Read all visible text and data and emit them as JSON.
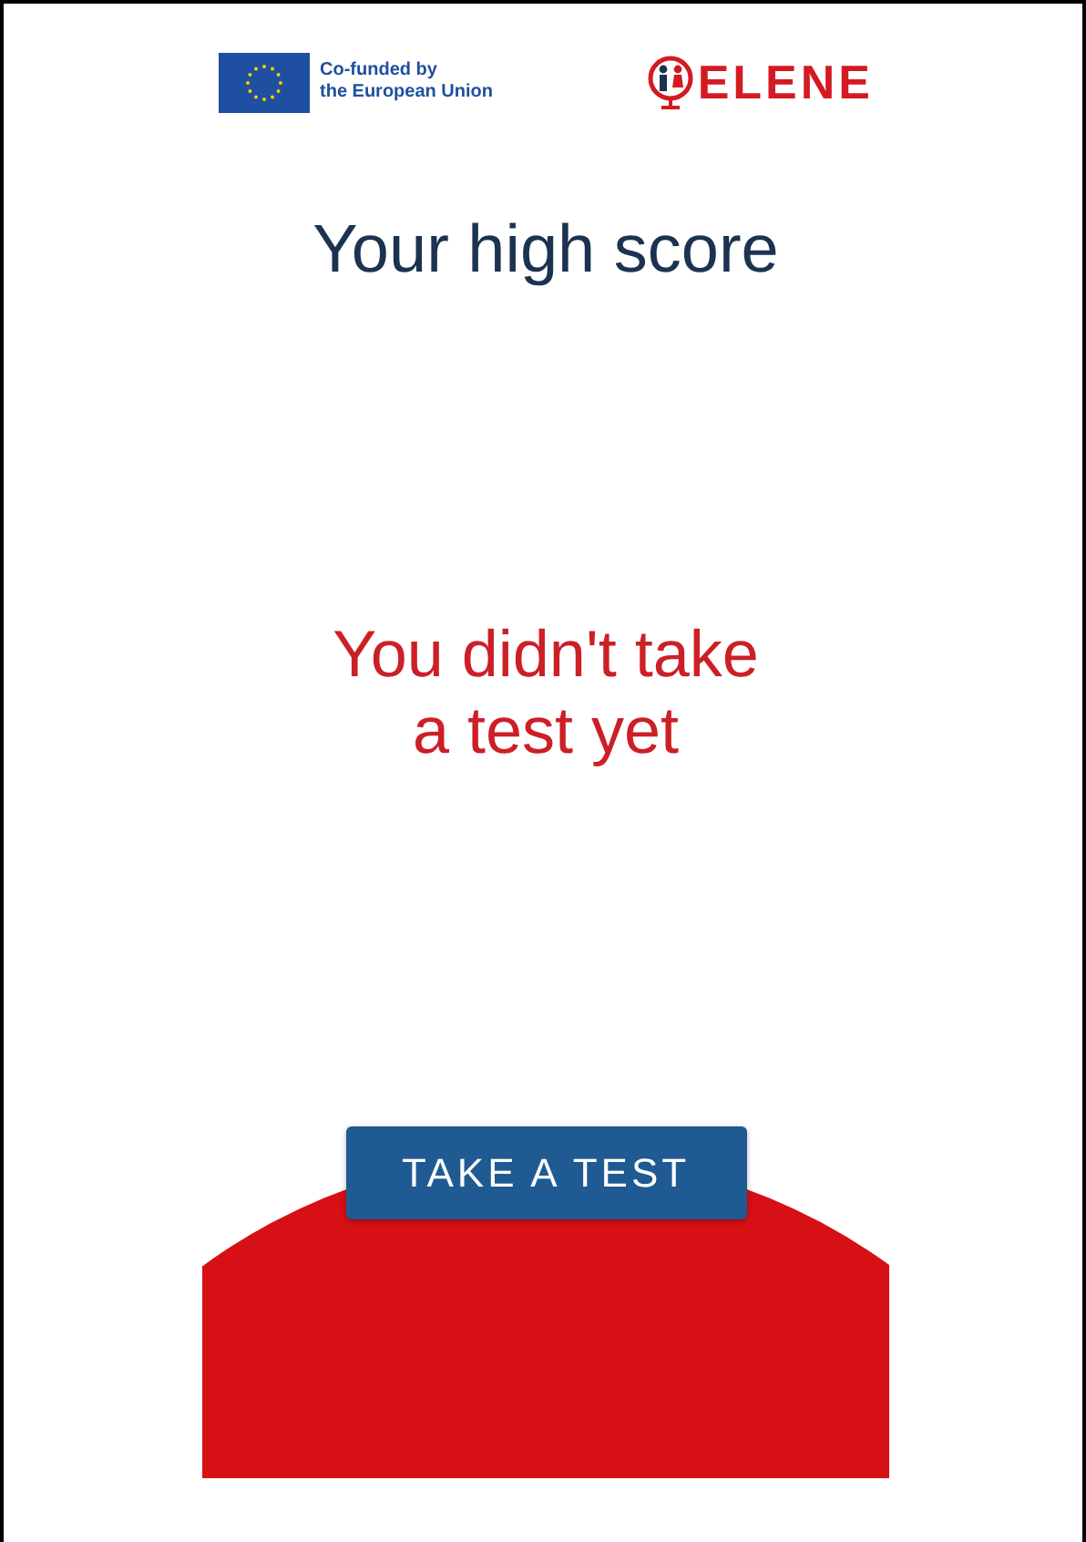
{
  "header": {
    "eu_label": "Co-funded by\nthe European Union",
    "logo_text": "ELENE"
  },
  "title": "Your high score",
  "message": "You didn't take\na test yet",
  "button": {
    "label": "TAKE A TEST"
  }
}
